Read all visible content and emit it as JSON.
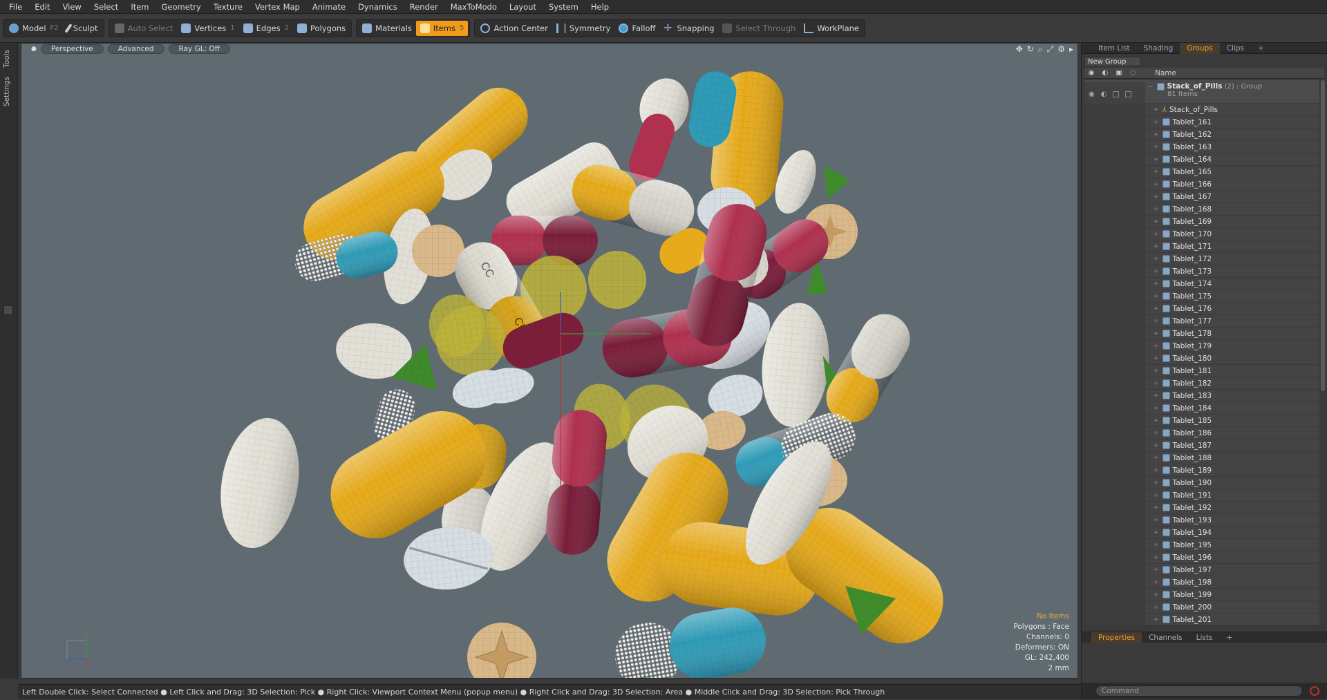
{
  "menu": [
    "File",
    "Edit",
    "View",
    "Select",
    "Item",
    "Geometry",
    "Texture",
    "Vertex Map",
    "Animate",
    "Dynamics",
    "Render",
    "MaxToModo",
    "Layout",
    "System",
    "Help"
  ],
  "toolbar": {
    "model": "Model",
    "model_key": "F2",
    "sculpt": "Sculpt",
    "auto_select": "Auto Select",
    "vertices": "Vertices",
    "vertices_key": "1",
    "edges": "Edges",
    "edges_key": "2",
    "polygons": "Polygons",
    "materials": "Materials",
    "items": "Items",
    "items_key": "5",
    "action_center": "Action Center",
    "symmetry": "Symmetry",
    "falloff": "Falloff",
    "snapping": "Snapping",
    "select_through": "Select Through",
    "workplane": "WorkPlane"
  },
  "lefttabs": {
    "tools": "Tools",
    "settings": "Settings"
  },
  "viewport": {
    "view": "Perspective",
    "shading": "Advanced",
    "raygl": "Ray GL: Off",
    "info": {
      "items": "No Items",
      "polygons": "Polygons : Face",
      "channels": "Channels: 0",
      "deformers": "Deformers: ON",
      "gl": "GL: 242,400",
      "unit": "2 mm"
    }
  },
  "panel": {
    "tabs": [
      "Item List",
      "Shading",
      "Groups",
      "Clips"
    ],
    "active_tab": "Groups",
    "new_group": "New Group",
    "name_header": "Name",
    "group_name": "Stack_of_Pills",
    "group_suffix": " (2) : Group",
    "group_count": "81 Items",
    "locator": "Stack_of_Pills",
    "items": [
      "Tablet_161",
      "Tablet_162",
      "Tablet_163",
      "Tablet_164",
      "Tablet_165",
      "Tablet_166",
      "Tablet_167",
      "Tablet_168",
      "Tablet_169",
      "Tablet_170",
      "Tablet_171",
      "Tablet_172",
      "Tablet_173",
      "Tablet_174",
      "Tablet_175",
      "Tablet_176",
      "Tablet_177",
      "Tablet_178",
      "Tablet_179",
      "Tablet_180",
      "Tablet_181",
      "Tablet_182",
      "Tablet_183",
      "Tablet_184",
      "Tablet_185",
      "Tablet_186",
      "Tablet_187",
      "Tablet_188",
      "Tablet_189",
      "Tablet_190",
      "Tablet_191",
      "Tablet_192",
      "Tablet_193",
      "Tablet_194",
      "Tablet_195",
      "Tablet_196",
      "Tablet_197",
      "Tablet_198",
      "Tablet_199",
      "Tablet_200",
      "Tablet_201"
    ],
    "bottom_tabs": [
      "Properties",
      "Channels",
      "Lists"
    ],
    "command_placeholder": "Command"
  },
  "status": "Left Double Click: Select Connected ● Left Click and Drag: 3D Selection: Pick ● Right Click: Viewport Context Menu (popup menu) ● Right Click and Drag: 3D Selection: Area ● Middle Click and Drag: 3D Selection: Pick Through",
  "pill_labels": {
    "cc": "CC",
    "cnc": "CNC"
  },
  "colors": {
    "accent": "#f29b1b",
    "viewport_bg": "#5f6a71",
    "yellow": "#e6aa1a",
    "white": "#e2e0d6",
    "maroon": "#b0304f",
    "blue": "#2f9bb7",
    "green": "#3f8a2a",
    "tan": "#d9b88a",
    "olive": "#bfb53a"
  }
}
